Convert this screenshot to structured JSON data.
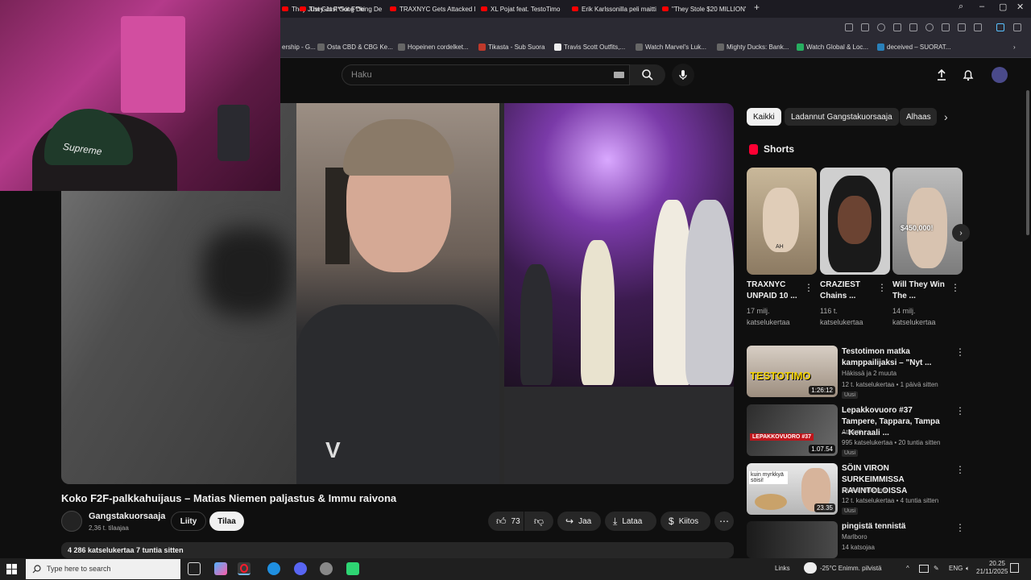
{
  "browser": {
    "tabs": [
      {
        "title": "They Just Got F**king De"
      },
      {
        "title": "TRAXNYC Gets Attacked I"
      },
      {
        "title": "XL Pojat feat. TestoTimo"
      },
      {
        "title": "Erik Karlssonilla peli maitti"
      },
      {
        "title": "\"They Stole $20 MILLION\""
      }
    ],
    "bookmarks": [
      "ership - G...",
      "Osta CBD & CBG Ke...",
      "Hopeinen cordelket...",
      "Tikasta - Sub Suora",
      "Travis Scott Outfits,...",
      "Watch Marvel's Luk...",
      "Mighty Ducks: Bank...",
      "Watch Global & Loc...",
      "deceived – SUORAT..."
    ]
  },
  "header": {
    "search_placeholder": "Haku"
  },
  "video": {
    "title": "Koko F2F-palkkahuijaus – Matias Niemen paljastus & Immu raivona",
    "channel": "Gangstakuorsaaja",
    "subscribers": "2,36 t. tilaajaa",
    "join_label": "Liity",
    "subscribe_label": "Tilaa",
    "likes": "73",
    "share_label": "Jaa",
    "download_label": "Lataa",
    "thanks_label": "Kiitos",
    "views_line": "4 286 katselukertaa  7 tuntia sitten",
    "logo_text": "V"
  },
  "webcam": {
    "hat_text": "Supreme"
  },
  "chips": [
    "Kaikki",
    "Ladannut Gangstakuorsaaja",
    "Alhaas"
  ],
  "shorts": {
    "section_title": "Shorts",
    "items": [
      {
        "title": "TRAXNYC UNPAID 10 ...",
        "views": "17 milj. katselukertaa",
        "thumb_text": "AH"
      },
      {
        "title": "CRAZIEST Chains ...",
        "views": "116 t. katselukertaa",
        "thumb_text": ""
      },
      {
        "title": "Will They Win The ...",
        "views": "14 milj. katselukertaa",
        "thumb_text": "$450,000!"
      }
    ]
  },
  "recommendations": [
    {
      "title": "Testotimon matka kamppailijaksi – \"Nyt ...",
      "channel": "Häkissä ja 2 muuta",
      "meta": "12 t. katselukertaa • 1 päivä sitten",
      "badge": "Uusi",
      "duration": "1:26:12",
      "thumb_text": "TESTOTIMO"
    },
    {
      "title": "Lepakkovuoro #37 Tampere, Tappara, Tampa – Kenraali ...",
      "channel": "Atleetti",
      "meta": "995 katselukertaa • 20 tuntia sitten",
      "badge": "Uusi",
      "duration": "1.07.54",
      "thumb_text": "LEPAKKOVUORO #37"
    },
    {
      "title": "SÖIN VIRON SURKEIMMISSA RAVINTOLOISSA",
      "channel": "Miska Haakana",
      "meta": "12 t. katselukertaa • 4 tuntia sitten",
      "badge": "Uusi",
      "duration": "23.35",
      "thumb_text": "kuin myrkkyä söisi!"
    },
    {
      "title": "pingistä tennistä",
      "channel": "Marlboro",
      "meta": "14 katsojaa",
      "badge": "",
      "duration": "",
      "thumb_text": ""
    }
  ],
  "taskbar": {
    "search_placeholder": "Type here to search",
    "links_label": "Links",
    "weather": "-25°C  Enimm. pilvistä",
    "lang": "ENG",
    "time": "20.25",
    "date": "21/11/2025"
  },
  "colors": {
    "yt_red": "#ff0033",
    "background": "#0f0f0f",
    "chip_bg": "#272727"
  }
}
